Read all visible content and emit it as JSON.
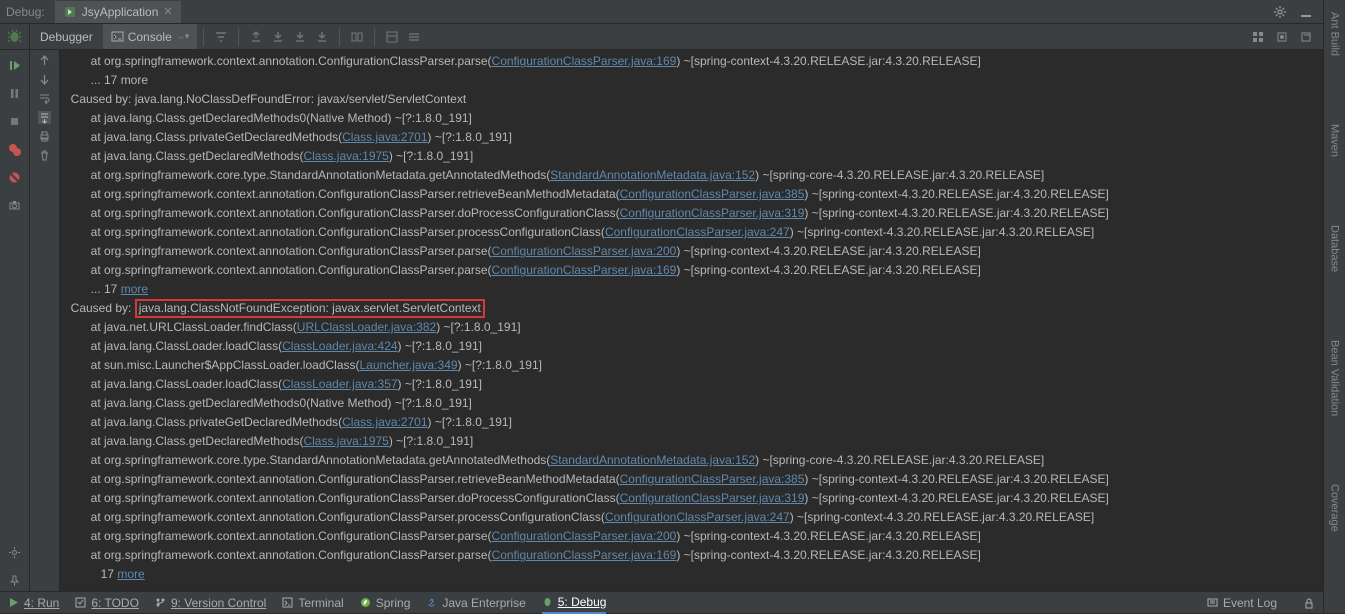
{
  "topbar": {
    "debug_label": "Debug:",
    "tab_name": "JsyApplication"
  },
  "toolrow": {
    "debugger_label": "Debugger",
    "console_label": "Console"
  },
  "right_tabs": [
    "Ant Build",
    "Maven",
    "Database",
    "Bean Validation",
    "Coverage"
  ],
  "bottom": {
    "run": "4: Run",
    "todo": "6: TODO",
    "vcs": "9: Version Control",
    "terminal": "Terminal",
    "spring": "Spring",
    "java_ee": "Java Enterprise",
    "debug": "5: Debug",
    "event_log": "Event Log"
  },
  "console_lines": [
    {
      "indent": 3,
      "t": "at org.springframework.context.annotation.ConfigurationClassParser.parse(",
      "link": "ConfigurationClassParser.java:169",
      "after": ") ~[spring-context-4.3.20.RELEASE.jar:4.3.20.RELEASE]"
    },
    {
      "indent": 3,
      "t": "... 17 more"
    },
    {
      "indent": 1,
      "t": "Caused by: java.lang.NoClassDefFoundError: javax/servlet/ServletContext"
    },
    {
      "indent": 3,
      "t": "at java.lang.Class.getDeclaredMethods0(Native Method) ~[?:1.8.0_191]"
    },
    {
      "indent": 3,
      "t": "at java.lang.Class.privateGetDeclaredMethods(",
      "link": "Class.java:2701",
      "after": ") ~[?:1.8.0_191]"
    },
    {
      "indent": 3,
      "t": "at java.lang.Class.getDeclaredMethods(",
      "link": "Class.java:1975",
      "after": ") ~[?:1.8.0_191]"
    },
    {
      "indent": 3,
      "t": "at org.springframework.core.type.StandardAnnotationMetadata.getAnnotatedMethods(",
      "link": "StandardAnnotationMetadata.java:152",
      "after": ") ~[spring-core-4.3.20.RELEASE.jar:4.3.20.RELEASE]"
    },
    {
      "indent": 3,
      "t": "at org.springframework.context.annotation.ConfigurationClassParser.retrieveBeanMethodMetadata(",
      "link": "ConfigurationClassParser.java:385",
      "after": ") ~[spring-context-4.3.20.RELEASE.jar:4.3.20.RELEASE]"
    },
    {
      "indent": 3,
      "t": "at org.springframework.context.annotation.ConfigurationClassParser.doProcessConfigurationClass(",
      "link": "ConfigurationClassParser.java:319",
      "after": ") ~[spring-context-4.3.20.RELEASE.jar:4.3.20.RELEASE]"
    },
    {
      "indent": 3,
      "t": "at org.springframework.context.annotation.ConfigurationClassParser.processConfigurationClass(",
      "link": "ConfigurationClassParser.java:247",
      "after": ") ~[spring-context-4.3.20.RELEASE.jar:4.3.20.RELEASE]"
    },
    {
      "indent": 3,
      "t": "at org.springframework.context.annotation.ConfigurationClassParser.parse(",
      "link": "ConfigurationClassParser.java:200",
      "after": ") ~[spring-context-4.3.20.RELEASE.jar:4.3.20.RELEASE]"
    },
    {
      "indent": 3,
      "t": "at org.springframework.context.annotation.ConfigurationClassParser.parse(",
      "link": "ConfigurationClassParser.java:169",
      "after": ") ~[spring-context-4.3.20.RELEASE.jar:4.3.20.RELEASE]"
    },
    {
      "indent": 3,
      "t": "... 17 ",
      "link": "more"
    },
    {
      "indent": 1,
      "t": "Caused by: ",
      "boxed": "java.lang.ClassNotFoundException: javax.servlet.ServletContext"
    },
    {
      "indent": 3,
      "t": "at java.net.URLClassLoader.findClass(",
      "link": "URLClassLoader.java:382",
      "after": ") ~[?:1.8.0_191]"
    },
    {
      "indent": 3,
      "t": "at java.lang.ClassLoader.loadClass(",
      "link": "ClassLoader.java:424",
      "after": ") ~[?:1.8.0_191]"
    },
    {
      "indent": 3,
      "t": "at sun.misc.Launcher$AppClassLoader.loadClass(",
      "link": "Launcher.java:349",
      "after": ") ~[?:1.8.0_191]"
    },
    {
      "indent": 3,
      "t": "at java.lang.ClassLoader.loadClass(",
      "link": "ClassLoader.java:357",
      "after": ") ~[?:1.8.0_191]"
    },
    {
      "indent": 3,
      "t": "at java.lang.Class.getDeclaredMethods0(Native Method) ~[?:1.8.0_191]"
    },
    {
      "indent": 3,
      "t": "at java.lang.Class.privateGetDeclaredMethods(",
      "link": "Class.java:2701",
      "after": ") ~[?:1.8.0_191]"
    },
    {
      "indent": 3,
      "t": "at java.lang.Class.getDeclaredMethods(",
      "link": "Class.java:1975",
      "after": ") ~[?:1.8.0_191]"
    },
    {
      "indent": 3,
      "t": "at org.springframework.core.type.StandardAnnotationMetadata.getAnnotatedMethods(",
      "link": "StandardAnnotationMetadata.java:152",
      "after": ") ~[spring-core-4.3.20.RELEASE.jar:4.3.20.RELEASE]"
    },
    {
      "indent": 3,
      "t": "at org.springframework.context.annotation.ConfigurationClassParser.retrieveBeanMethodMetadata(",
      "link": "ConfigurationClassParser.java:385",
      "after": ") ~[spring-context-4.3.20.RELEASE.jar:4.3.20.RELEASE]"
    },
    {
      "indent": 3,
      "t": "at org.springframework.context.annotation.ConfigurationClassParser.doProcessConfigurationClass(",
      "link": "ConfigurationClassParser.java:319",
      "after": ") ~[spring-context-4.3.20.RELEASE.jar:4.3.20.RELEASE]"
    },
    {
      "indent": 3,
      "t": "at org.springframework.context.annotation.ConfigurationClassParser.processConfigurationClass(",
      "link": "ConfigurationClassParser.java:247",
      "after": ") ~[spring-context-4.3.20.RELEASE.jar:4.3.20.RELEASE]"
    },
    {
      "indent": 3,
      "t": "at org.springframework.context.annotation.ConfigurationClassParser.parse(",
      "link": "ConfigurationClassParser.java:200",
      "after": ") ~[spring-context-4.3.20.RELEASE.jar:4.3.20.RELEASE]"
    },
    {
      "indent": 3,
      "t": "at org.springframework.context.annotation.ConfigurationClassParser.parse(",
      "link": "ConfigurationClassParser.java:169",
      "after": ") ~[spring-context-4.3.20.RELEASE.jar:4.3.20.RELEASE]"
    },
    {
      "indent": 3,
      "t": "   17 ",
      "link": "more"
    }
  ]
}
